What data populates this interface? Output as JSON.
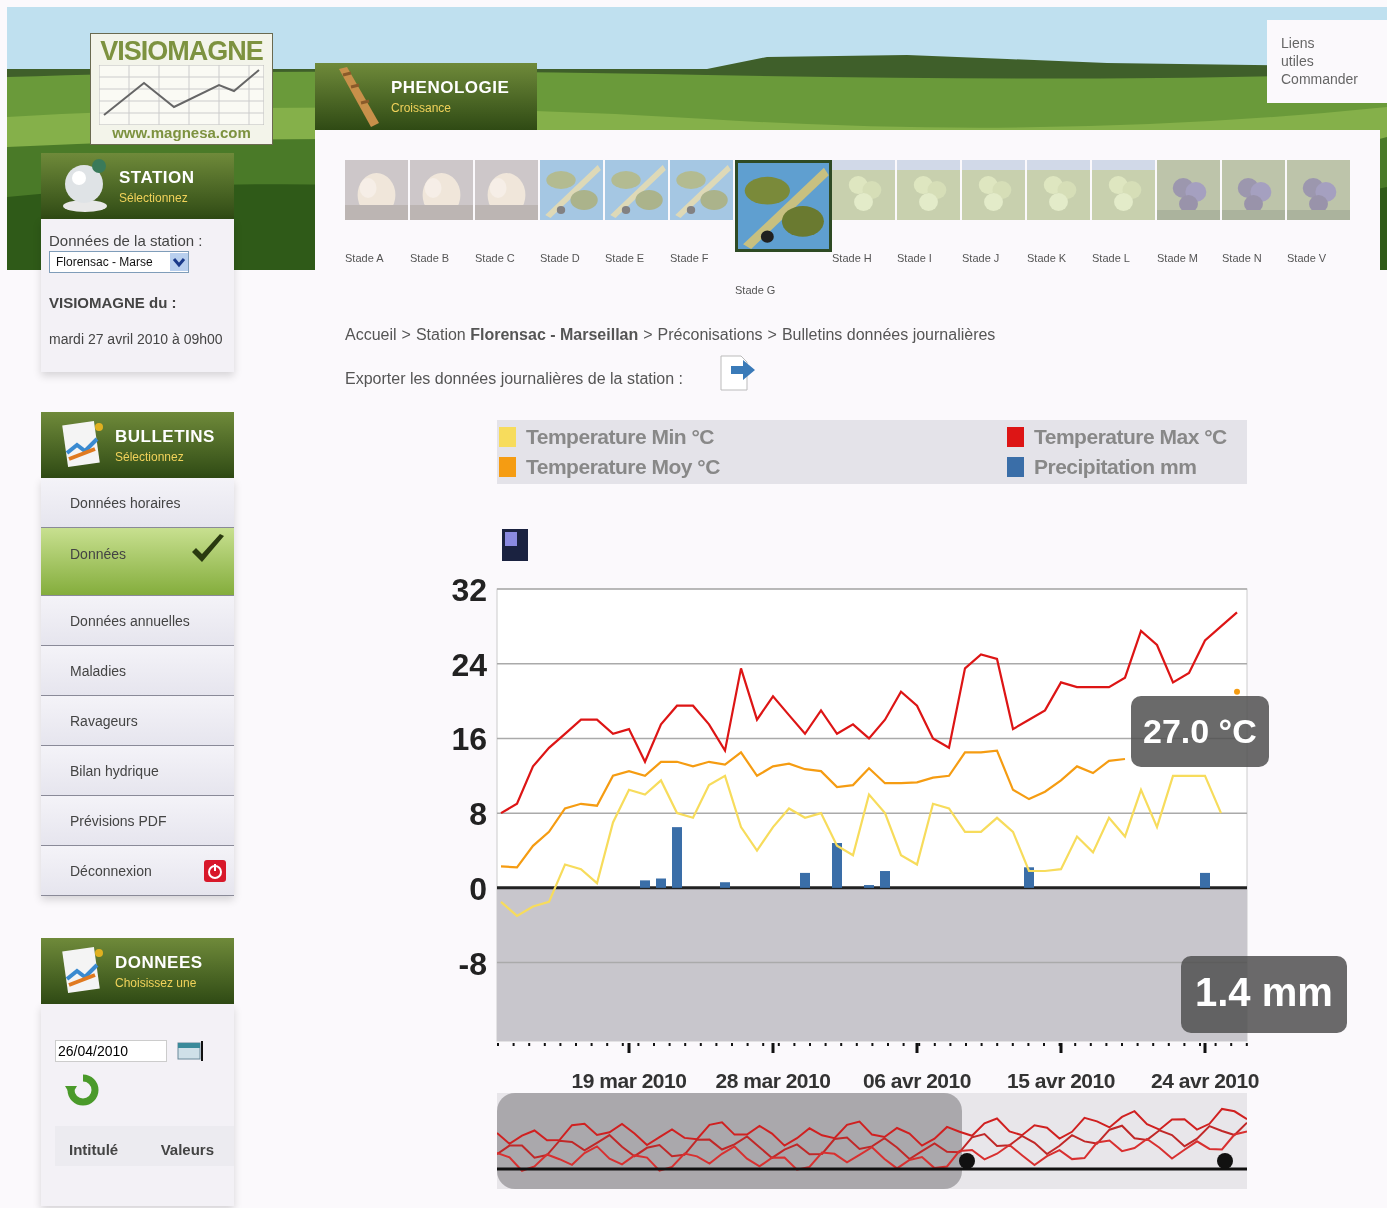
{
  "header": {
    "logo": {
      "title": "VISIOMAGNE",
      "url": "www.magnesa.com"
    },
    "links": [
      "Liens utiles",
      "Commander"
    ]
  },
  "station": {
    "title": "STATION",
    "subtitle": "Sélectionnez",
    "label": "Données de la station :",
    "select_value": "Florensac - Marse",
    "date_label": "VISIOMAGNE du :",
    "date": "mardi 27 avril 2010 à 09h00"
  },
  "bulletins": {
    "title": "BULLETINS",
    "subtitle": "Sélectionnez",
    "items": [
      {
        "label": "Données horaires",
        "selected": false,
        "kind": "link"
      },
      {
        "label": "Données",
        "selected": true,
        "kind": "link"
      },
      {
        "label": "Données annuelles",
        "selected": false,
        "kind": "link"
      },
      {
        "label": "Maladies",
        "selected": false,
        "kind": "link"
      },
      {
        "label": "Ravageurs",
        "selected": false,
        "kind": "link"
      },
      {
        "label": "Bilan hydrique",
        "selected": false,
        "kind": "link"
      },
      {
        "label": "Prévisions PDF",
        "selected": false,
        "kind": "link"
      },
      {
        "label": "Déconnexion",
        "selected": false,
        "kind": "logout"
      }
    ]
  },
  "donnees": {
    "title": "DONNEES",
    "subtitle": "Choisissez une",
    "date_value": "26/04/2010",
    "columns": [
      "Intitulé",
      "Valeurs"
    ]
  },
  "phenologie": {
    "title": "PHENOLOGIE",
    "subtitle": "Croissance",
    "stages": [
      {
        "label": "Stade A",
        "selected": false
      },
      {
        "label": "Stade B",
        "selected": false
      },
      {
        "label": "Stade C",
        "selected": false
      },
      {
        "label": "Stade D",
        "selected": false
      },
      {
        "label": "Stade E",
        "selected": false
      },
      {
        "label": "Stade F",
        "selected": false
      },
      {
        "label": "Stade G",
        "selected": true
      },
      {
        "label": "Stade H",
        "selected": false
      },
      {
        "label": "Stade I",
        "selected": false
      },
      {
        "label": "Stade J",
        "selected": false
      },
      {
        "label": "Stade K",
        "selected": false
      },
      {
        "label": "Stade L",
        "selected": false
      },
      {
        "label": "Stade M",
        "selected": false
      },
      {
        "label": "Stade N",
        "selected": false
      },
      {
        "label": "Stade V",
        "selected": false
      }
    ]
  },
  "breadcrumb": {
    "separator": ">",
    "items": [
      "Accueil",
      "Station **Florensac - Marseillan**",
      "Préconisations",
      "Bulletins données journalières"
    ]
  },
  "export": {
    "label": "Exporter les données journalières de la station :"
  },
  "chart": {
    "chart_data": {
      "type": "line",
      "categories": [
        null,
        null,
        null,
        null,
        null,
        null,
        null,
        null,
        "19 mar 2010",
        null,
        null,
        null,
        null,
        null,
        null,
        null,
        null,
        "28 mar 2010",
        null,
        null,
        null,
        null,
        null,
        null,
        null,
        null,
        "06 avr 2010",
        null,
        null,
        null,
        null,
        null,
        null,
        null,
        null,
        "15 avr 2010",
        null,
        null,
        null,
        null,
        null,
        null,
        null,
        null,
        "24 avr 2010",
        null,
        null
      ],
      "ylim": [
        -16.4,
        32
      ],
      "grid": true,
      "bands": [
        {
          "axis": "y",
          "from": -16.4,
          "to": 0,
          "color": "#c8c6cc"
        }
      ],
      "yticks": [
        -8,
        0,
        8,
        16,
        24,
        32
      ],
      "series": [
        {
          "name": "Temperature Min °C",
          "color": "#f7dc5c",
          "values": [
            -1.5,
            -3,
            -2,
            -1.5,
            2.5,
            2,
            0.5,
            7,
            10.5,
            10,
            11.5,
            8,
            7.5,
            11,
            12,
            6.5,
            4,
            6.5,
            8.5,
            7.5,
            8,
            4.5,
            3.5,
            10,
            8,
            3.5,
            2.5,
            9,
            8.5,
            6,
            6,
            7.5,
            6,
            1.8,
            1.8,
            2,
            5.5,
            3.8,
            7.5,
            5.5,
            10.5,
            6.5,
            12,
            12,
            12,
            8,
            null
          ]
        },
        {
          "name": "Temperature Moy °C",
          "color": "#f59c12",
          "values": [
            2.3,
            2.2,
            4.5,
            6,
            8.5,
            9,
            8.8,
            12,
            12.5,
            12,
            13.5,
            13.5,
            13,
            13.5,
            13.2,
            14.5,
            12,
            13,
            13.3,
            12.7,
            12.5,
            10.8,
            11,
            12.8,
            11.2,
            11.2,
            11.3,
            11.8,
            12,
            14.5,
            14.5,
            14.7,
            10.5,
            9.5,
            10.3,
            11.5,
            13,
            12.3,
            13.6,
            13.8,
            null,
            null,
            null,
            null,
            null,
            null,
            21
          ]
        },
        {
          "name": "Temperature Max °C",
          "color": "#dd1515",
          "values": [
            8,
            9,
            13,
            15,
            16.5,
            18,
            18,
            16.5,
            17,
            13.5,
            17.5,
            19.5,
            19.5,
            17.5,
            14.7,
            23.5,
            18,
            20.5,
            18.5,
            16.5,
            19,
            16.5,
            17.5,
            16,
            18,
            21,
            19.5,
            16,
            15,
            23.5,
            25,
            24.5,
            17,
            18,
            19,
            22,
            21.5,
            21.5,
            21.5,
            22.5,
            27.5,
            26,
            22,
            23,
            26.5,
            28,
            29.5
          ]
        },
        {
          "name": "Precipitation mm",
          "color": "#3a6ea8",
          "type": "bar",
          "values": [
            0,
            0,
            0,
            0,
            0,
            0,
            0,
            0,
            0,
            0.8,
            1,
            6.5,
            0,
            0,
            0.6,
            0,
            0,
            0,
            0,
            1.6,
            0,
            4.8,
            0,
            0.3,
            1.8,
            0,
            0,
            0,
            0,
            0,
            0,
            0,
            0,
            2.2,
            0,
            0,
            0,
            0,
            0,
            0,
            0,
            0,
            0,
            0,
            1.6,
            0,
            0
          ]
        }
      ],
      "annotations": [
        {
          "text": "27.0 °C"
        },
        {
          "text": "1.4 mm"
        }
      ]
    }
  }
}
